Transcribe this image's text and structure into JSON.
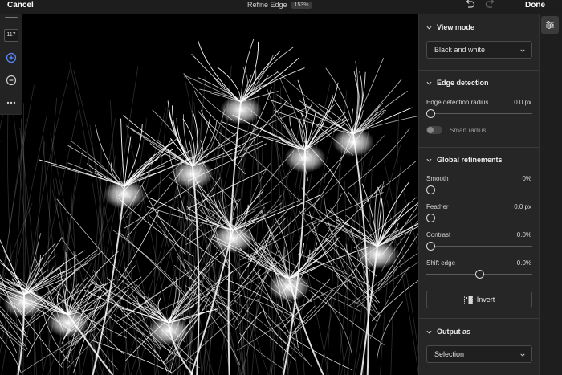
{
  "topbar": {
    "cancel_label": "Cancel",
    "title": "Refine Edge",
    "zoom": "153%",
    "done_label": "Done"
  },
  "tools": {
    "brush_size": "117",
    "icons": [
      "brush-add-icon",
      "brush-subtract-icon",
      "more-icon"
    ]
  },
  "panel": {
    "view_mode": {
      "title": "View mode",
      "selected": "Black and white"
    },
    "edge_detection": {
      "title": "Edge detection",
      "radius_label": "Edge detection radius",
      "radius_value": "0.0 px",
      "radius_level": 0,
      "smart_radius_label": "Smart radius",
      "smart_radius_on": false
    },
    "global_refinements": {
      "title": "Global refinements",
      "smooth_label": "Smooth",
      "smooth_value": "0%",
      "smooth_level": 0,
      "feather_label": "Feather",
      "feather_value": "0.0 px",
      "feather_level": 0,
      "contrast_label": "Contrast",
      "contrast_value": "0.0%",
      "contrast_level": 0,
      "shift_label": "Shift edge",
      "shift_value": "0.0%",
      "shift_level": 0.5,
      "invert_label": "Invert"
    },
    "output": {
      "title": "Output as",
      "selected": "Selection"
    }
  },
  "colors": {
    "panel_bg": "#262626",
    "canvas_bg": "#000000",
    "text": "#e6e6e6"
  }
}
